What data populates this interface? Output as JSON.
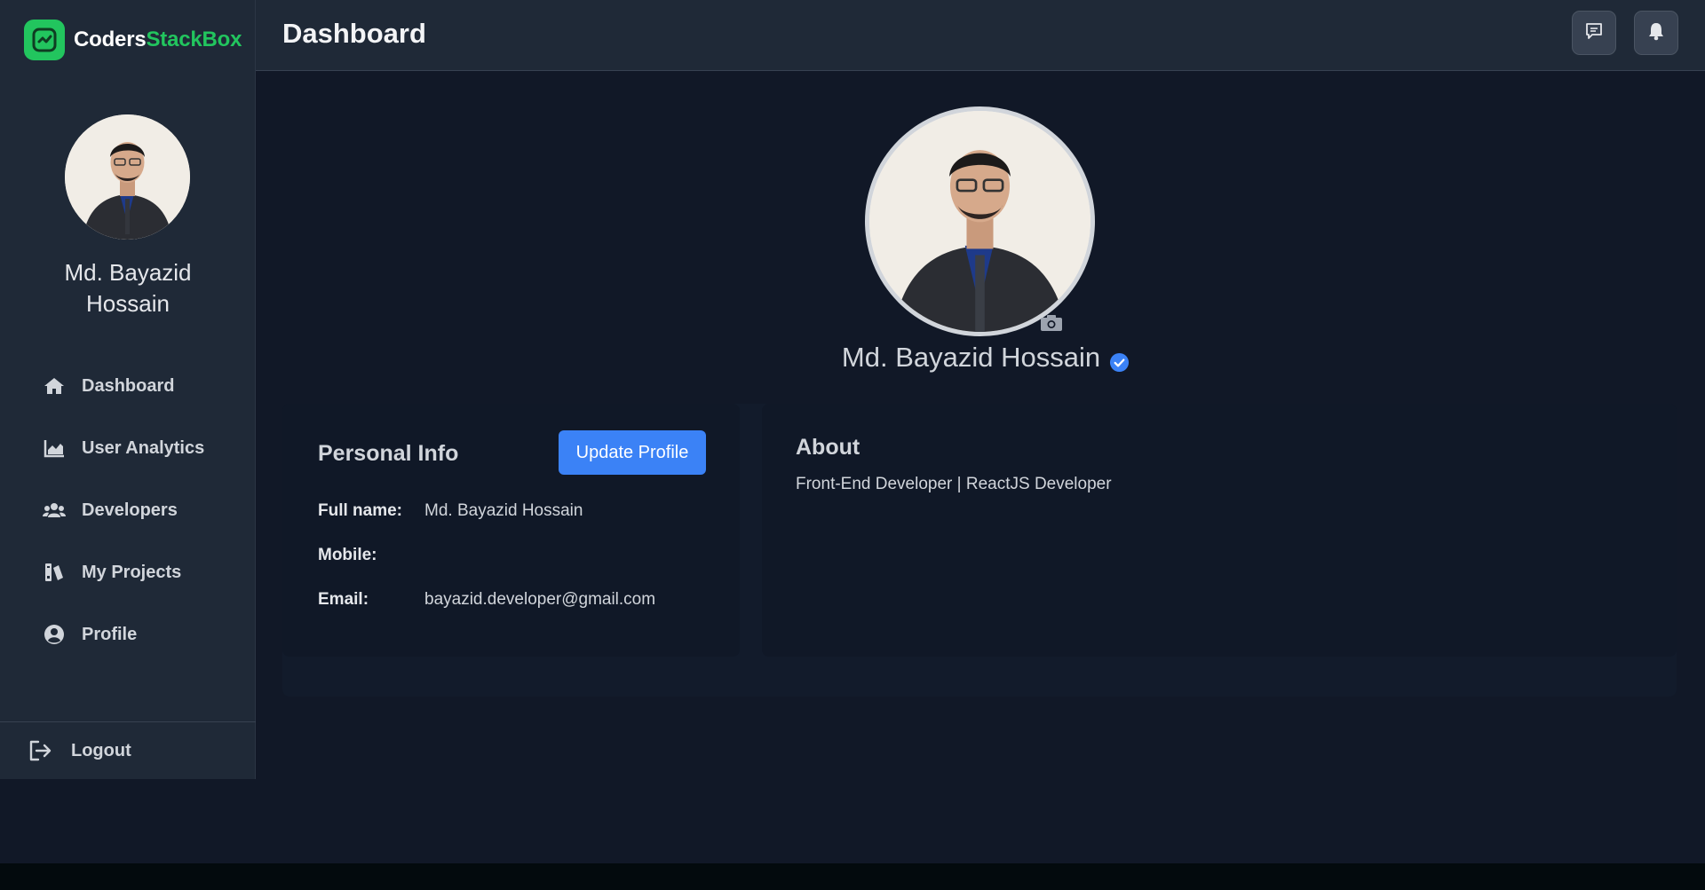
{
  "brand": {
    "name_white": "Coders",
    "name_green": "StackBox",
    "accent": "#22c55e"
  },
  "header": {
    "title": "Dashboard",
    "message_icon": "message-icon",
    "bell_icon": "bell-icon"
  },
  "sidebar": {
    "user_name": "Md. Bayazid Hossain",
    "items": [
      {
        "label": "Dashboard",
        "icon": "home-icon"
      },
      {
        "label": "User Analytics",
        "icon": "area-chart-icon"
      },
      {
        "label": "Developers",
        "icon": "users-icon"
      },
      {
        "label": "My Projects",
        "icon": "projects-icon"
      },
      {
        "label": "Profile",
        "icon": "user-circle-icon"
      }
    ],
    "logout_label": "Logout"
  },
  "profile": {
    "name": "Md. Bayazid Hossain",
    "verified": true,
    "verified_color": "#3b82f6"
  },
  "personal_info": {
    "title": "Personal Info",
    "update_button": "Update Profile",
    "fields": [
      {
        "label": "Full name:",
        "value": "Md. Bayazid Hossain"
      },
      {
        "label": "Mobile:",
        "value": ""
      },
      {
        "label": "Email:",
        "value": "bayazid.developer@gmail.com"
      }
    ]
  },
  "about": {
    "title": "About",
    "text": "Front-End Developer | ReactJS Developer"
  }
}
